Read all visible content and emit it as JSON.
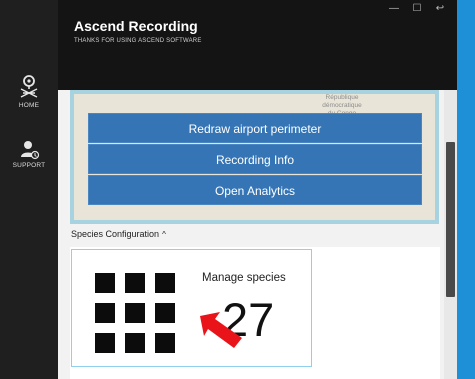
{
  "app": {
    "title": "Ascend Recording",
    "subtitle": "THANKS FOR USING ASCEND SOFTWARE"
  },
  "window_controls": {
    "minimize_glyph": "—",
    "maximize_glyph": "☐",
    "back_glyph": "↩"
  },
  "sidebar": {
    "items": [
      {
        "label": "HOME",
        "icon": "home-pin-icon"
      },
      {
        "label": "SUPPORT",
        "icon": "support-user-icon"
      }
    ]
  },
  "map": {
    "labels": [
      "République\ndémocratique\ndu Congo"
    ]
  },
  "menu": {
    "items": [
      {
        "label": "Redraw airport perimeter"
      },
      {
        "label": "Recording Info"
      },
      {
        "label": "Open Analytics"
      }
    ]
  },
  "species": {
    "section_label": "Species Configuration",
    "chevron": "^",
    "card_title": "Manage species",
    "count": "27",
    "icon": "grid-icon"
  },
  "colors": {
    "accent": "#1e90d8",
    "menu_button": "#3575b5",
    "card_border": "#8fd0ee",
    "arrow": "#e8141a"
  }
}
